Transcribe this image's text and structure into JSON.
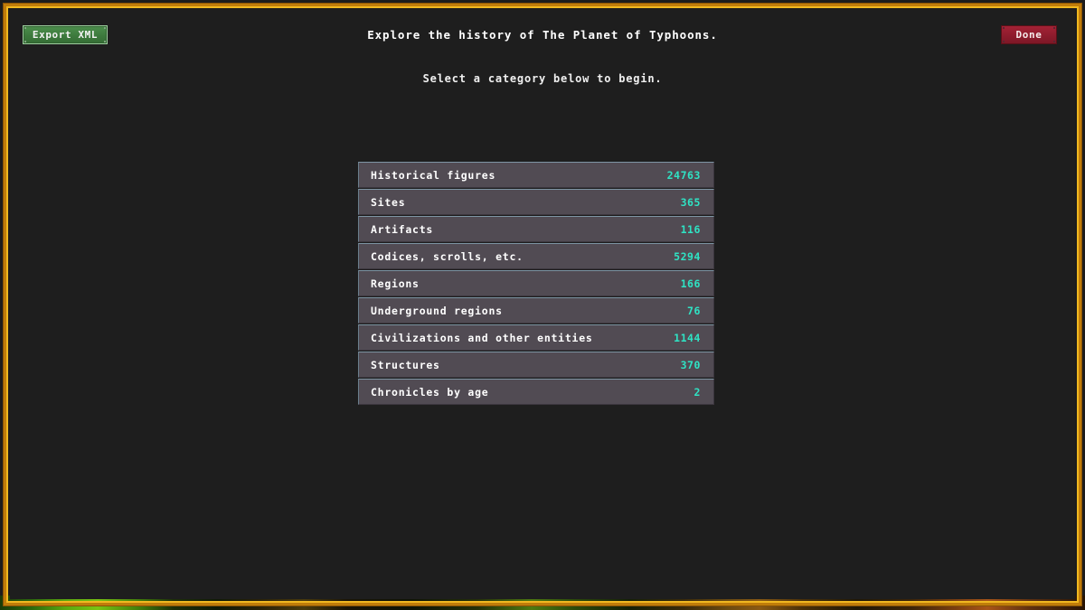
{
  "window": {
    "frame_color": "#f0b820",
    "frame_shadow_color": "#c07c0a",
    "background_color": "#1e1e1e"
  },
  "toolbar": {
    "export_xml_label": "Export XML",
    "export_xml_color": "#3d7a3d",
    "done_label": "Done",
    "done_color": "#8e1c2d"
  },
  "header": {
    "title": "Explore the history of The Planet of Typhoons.",
    "subtitle": "Select a category below to begin."
  },
  "categories": {
    "count_color": "#2fe3c4",
    "row_color": "#514b53",
    "items": [
      {
        "label": "Historical figures",
        "count": "24763"
      },
      {
        "label": "Sites",
        "count": "365"
      },
      {
        "label": "Artifacts",
        "count": "116"
      },
      {
        "label": "Codices, scrolls, etc.",
        "count": "5294"
      },
      {
        "label": "Regions",
        "count": "166"
      },
      {
        "label": "Underground regions",
        "count": "76"
      },
      {
        "label": "Civilizations and other entities",
        "count": "1144"
      },
      {
        "label": "Structures",
        "count": "370"
      },
      {
        "label": "Chronicles by age",
        "count": "2"
      }
    ]
  }
}
